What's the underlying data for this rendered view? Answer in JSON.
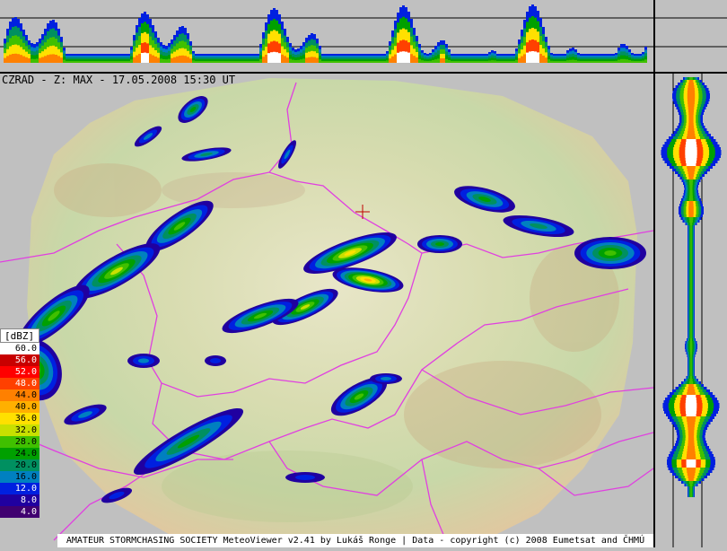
{
  "title": "CZRAD - Z: MAX - 17.05.2008 15:30 UT",
  "legend": {
    "unit": "[dBZ]",
    "entries": [
      {
        "label": "60.0",
        "color": "#ffffff",
        "text": "#000000"
      },
      {
        "label": "56.0",
        "color": "#c80000",
        "text": "#ffffff"
      },
      {
        "label": "52.0",
        "color": "#ff0000",
        "text": "#ffffff"
      },
      {
        "label": "48.0",
        "color": "#ff4000",
        "text": "#ffffff"
      },
      {
        "label": "44.0",
        "color": "#ff8000",
        "text": "#000000"
      },
      {
        "label": "40.0",
        "color": "#ffb000",
        "text": "#000000"
      },
      {
        "label": "36.0",
        "color": "#ffe000",
        "text": "#000000"
      },
      {
        "label": "32.0",
        "color": "#c8e000",
        "text": "#000000"
      },
      {
        "label": "28.0",
        "color": "#40c000",
        "text": "#000000"
      },
      {
        "label": "24.0",
        "color": "#00a000",
        "text": "#000000"
      },
      {
        "label": "20.0",
        "color": "#009060",
        "text": "#000000"
      },
      {
        "label": "16.0",
        "color": "#0080c0",
        "text": "#000000"
      },
      {
        "label": "12.0",
        "color": "#0020e0",
        "text": "#ffffff"
      },
      {
        "label": "8.0",
        "color": "#2000a0",
        "text": "#ffffff"
      },
      {
        "label": "4.0",
        "color": "#400070",
        "text": "#ffffff"
      }
    ]
  },
  "footer": "AMATEUR STORMCHASING SOCIETY MeteoViewer v2.41 by Lukáš Ronge | Data - copyright (c) 2008 Eumetsat and ČHMÚ"
}
